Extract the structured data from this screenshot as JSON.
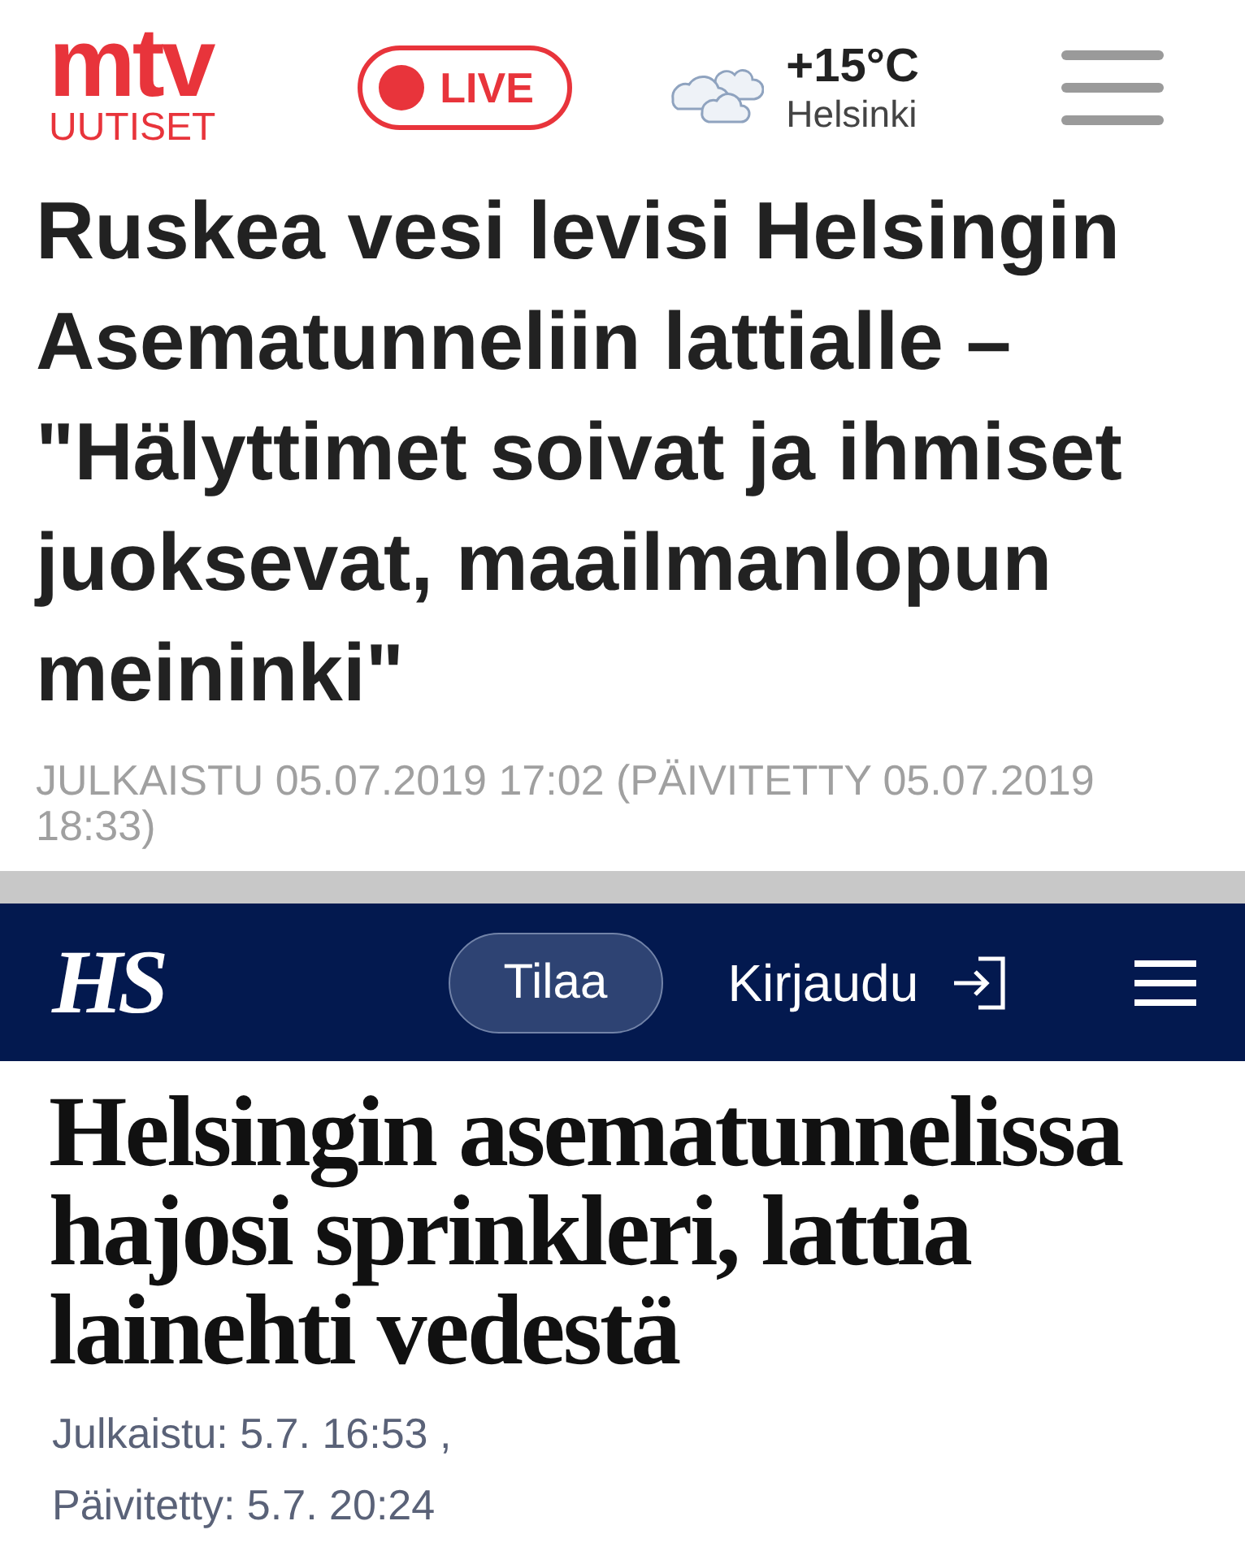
{
  "mtv": {
    "logo": {
      "brand": "mtv",
      "subtitle": "UUTISET"
    },
    "live_button": "LIVE",
    "weather": {
      "temperature": "+15°C",
      "city": "Helsinki"
    },
    "headline": "Ruskea vesi levisi Helsingin Asematunneliin lattialle – \"Hälyttimet soivat ja ihmiset juoksevat, maailmanlopun meininki\"",
    "timestamp": "JULKAISTU 05.07.2019 17:02 (PÄIVITETTY 05.07.2019 18:33)"
  },
  "hs": {
    "logo": "HS",
    "subscribe_button": "Tilaa",
    "login_button": "Kirjaudu",
    "headline": "Helsingin asematunnelissa hajosi sprinkleri, lattia lainehti vedestä",
    "published": "Julkaistu: 5.7. 16:53 ,",
    "updated": "Päivitetty: 5.7. 20:24"
  }
}
